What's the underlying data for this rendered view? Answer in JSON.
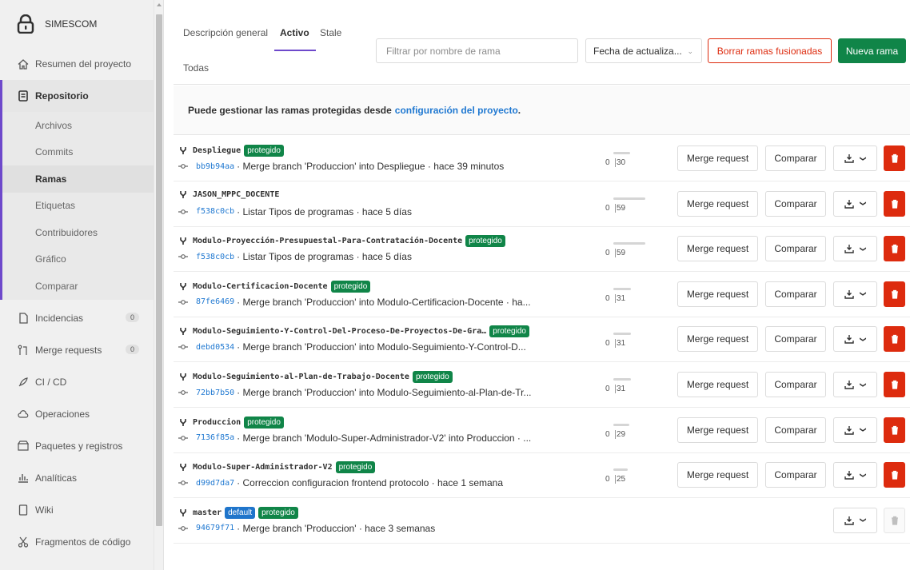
{
  "project": {
    "name": "SIMESCOM"
  },
  "sidebar": {
    "overview": "Resumen del proyecto",
    "repository": "Repositorio",
    "repo_sub": [
      "Archivos",
      "Commits",
      "Ramas",
      "Etiquetas",
      "Contribuidores",
      "Gráfico",
      "Comparar"
    ],
    "issues": {
      "label": "Incidencias",
      "count": "0"
    },
    "merge_requests": {
      "label": "Merge requests",
      "count": "0"
    },
    "cicd": "CI / CD",
    "operations": "Operaciones",
    "packages": "Paquetes y registros",
    "analytics": "Analíticas",
    "wiki": "Wiki",
    "snippets": "Fragmentos de código"
  },
  "tabs": {
    "overview": "Descripción general",
    "active": "Activo",
    "stale": "Stale",
    "all": "Todas"
  },
  "toolbar": {
    "filter_placeholder": "Filtrar por nombre de rama",
    "sort_value": "Fecha de actualiza...",
    "delete_merged": "Borrar ramas fusionadas",
    "new_branch": "Nueva rama"
  },
  "notice": {
    "text": "Puede gestionar las ramas protegidas desde",
    "link": "configuración del proyecto",
    "end": "."
  },
  "labels": {
    "merge_request": "Merge request",
    "compare": "Comparar",
    "protected": "protegido",
    "default": "default"
  },
  "colors": {
    "accent": "#6e49cb",
    "link": "#1f78d1",
    "success": "#108548",
    "danger": "#dd2b0e"
  },
  "branches": [
    {
      "name": "Despliegue",
      "protected": true,
      "default": false,
      "sha": "bb9b94aa",
      "message": "· Merge branch 'Produccion' into Despliegue · hace 39 minutos",
      "behind": "0",
      "ahead": "30",
      "deletable": true
    },
    {
      "name": "JASON_MPPC_DOCENTE",
      "protected": false,
      "default": false,
      "sha": "f538c0cb",
      "message": "· Listar Tipos de programas · hace 5 días",
      "behind": "0",
      "ahead": "59",
      "deletable": true
    },
    {
      "name": "Modulo-Proyección-Presupuestal-Para-Contratación-Docente",
      "protected": true,
      "default": false,
      "sha": "f538c0cb",
      "message": "· Listar Tipos de programas · hace 5 días",
      "behind": "0",
      "ahead": "59",
      "deletable": true
    },
    {
      "name": "Modulo-Certificacion-Docente",
      "protected": true,
      "default": false,
      "sha": "87fe6469",
      "message": "· Merge branch 'Produccion' into Modulo-Certificacion-Docente · ha...",
      "behind": "0",
      "ahead": "31",
      "deletable": true
    },
    {
      "name": "Modulo-Seguimiento-Y-Control-Del-Proceso-De-Proyectos-De-Gra…",
      "protected": true,
      "default": false,
      "sha": "debd0534",
      "message": "· Merge branch 'Produccion' into Modulo-Seguimiento-Y-Control-D...",
      "behind": "0",
      "ahead": "31",
      "deletable": true
    },
    {
      "name": "Modulo-Seguimiento-al-Plan-de-Trabajo-Docente",
      "protected": true,
      "default": false,
      "sha": "72bb7b50",
      "message": "· Merge branch 'Produccion' into Modulo-Seguimiento-al-Plan-de-Tr...",
      "behind": "0",
      "ahead": "31",
      "deletable": true
    },
    {
      "name": "Produccion",
      "protected": true,
      "default": false,
      "sha": "7136f85a",
      "message": "· Merge branch 'Modulo-Super-Administrador-V2' into Produccion · ...",
      "behind": "0",
      "ahead": "29",
      "deletable": true
    },
    {
      "name": "Modulo-Super-Administrador-V2",
      "protected": true,
      "default": false,
      "sha": "d99d7da7",
      "message": "· Correccion configuracion frontend protocolo · hace 1 semana",
      "behind": "0",
      "ahead": "25",
      "deletable": true
    },
    {
      "name": "master",
      "protected": true,
      "default": true,
      "sha": "94679f71",
      "message": "· Merge branch 'Produccion' · hace 3 semanas",
      "behind": null,
      "ahead": null,
      "deletable": false
    }
  ]
}
